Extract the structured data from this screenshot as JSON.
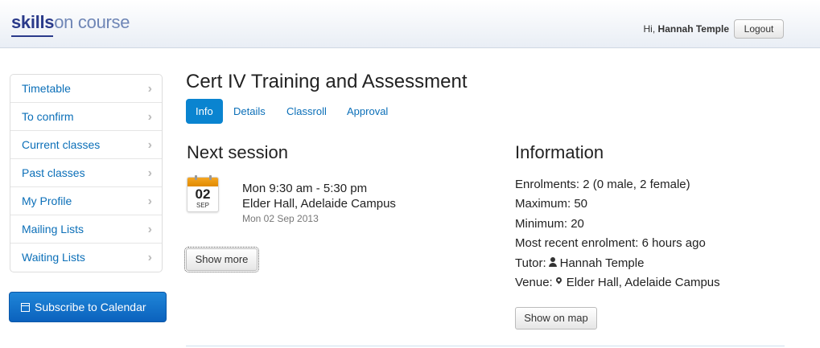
{
  "header": {
    "logo_part1": "skills",
    "logo_part2": "on course",
    "greeting": "Hi,",
    "user_name": "Hannah Temple",
    "logout_label": "Logout"
  },
  "sidebar": {
    "items": [
      {
        "label": "Timetable"
      },
      {
        "label": "To confirm"
      },
      {
        "label": "Current classes"
      },
      {
        "label": "Past classes"
      },
      {
        "label": "My Profile"
      },
      {
        "label": "Mailing Lists"
      },
      {
        "label": "Waiting Lists"
      }
    ],
    "chevron": "›",
    "subscribe_label": "Subscribe to Calendar"
  },
  "main": {
    "title": "Cert IV Training and Assessment",
    "tabs": [
      {
        "label": "Info",
        "active": true
      },
      {
        "label": "Details"
      },
      {
        "label": "Classroll"
      },
      {
        "label": "Approval"
      }
    ],
    "next_session": {
      "heading": "Next session",
      "cal_day": "02",
      "cal_month": "SEP",
      "time": "Mon 9:30 am - 5:30 pm",
      "venue": "Elder Hall, Adelaide Campus",
      "date": "Mon 02 Sep 2013",
      "show_more_label": "Show more"
    },
    "information": {
      "heading": "Information",
      "enrolments_label": "Enrolments:",
      "enrolments_value": "2 (0 male, 2 female)",
      "maximum_label": "Maximum:",
      "maximum_value": "50",
      "minimum_label": "Minimum:",
      "minimum_value": "20",
      "recent_label": "Most recent enrolment:",
      "recent_value": "6 hours ago",
      "tutor_label": "Tutor:",
      "tutor_value": "Hannah Temple",
      "venue_label": "Venue:",
      "venue_value": "Elder Hall, Adelaide Campus",
      "show_map_label": "Show on map"
    }
  },
  "colors": {
    "link": "#0b6fb8",
    "tab_active": "#0a84d0",
    "subscribe_button": "#1f86d8",
    "logo_primary": "#2a3a8a",
    "calendar_accent": "#f5a623"
  }
}
